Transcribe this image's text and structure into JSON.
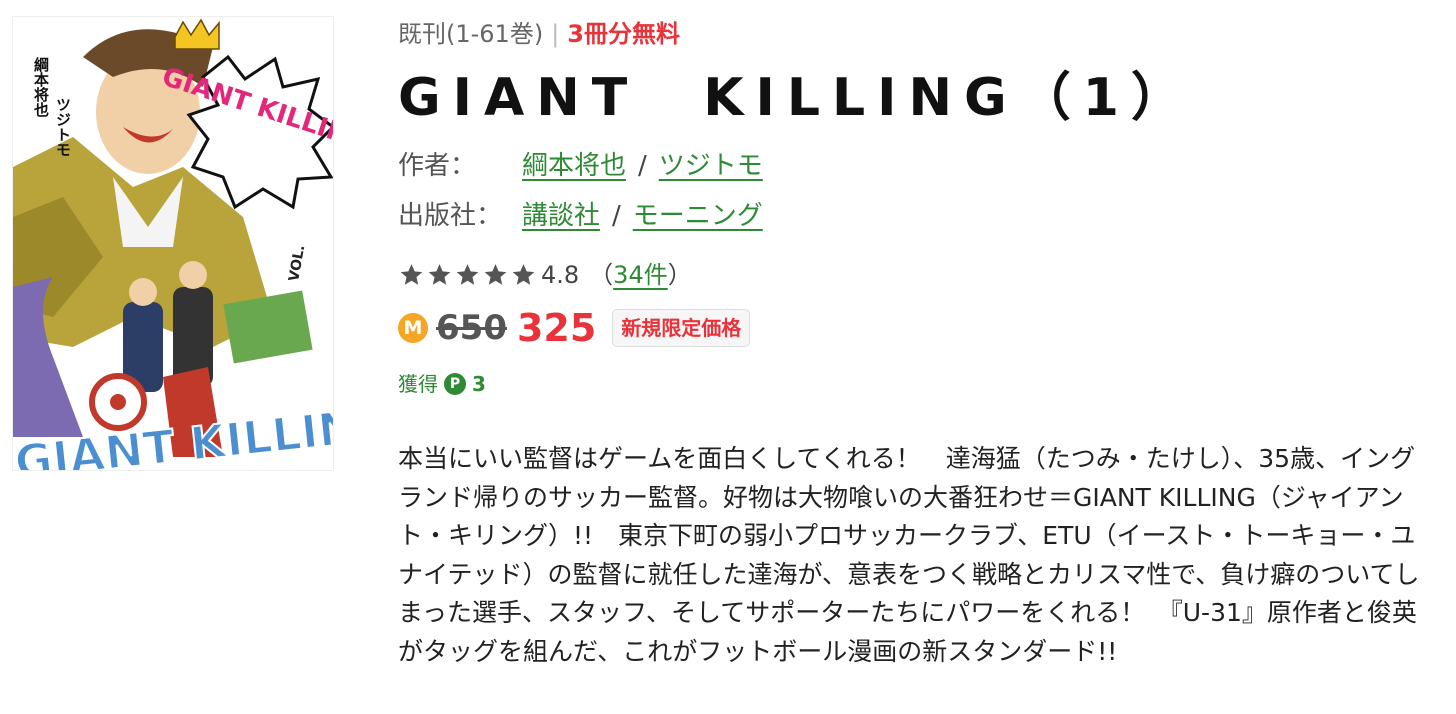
{
  "cover": {
    "alt": "GIANT KILLING 1 cover",
    "logo_text": "GIANT KILLING",
    "vol_text": "VOL.",
    "bottom_text": "GIANT KILLING",
    "authors_vertical": [
      "綱本将也",
      "ツジトモ"
    ]
  },
  "meta": {
    "volume_range": "既刊(1-61巻)",
    "separator": "|",
    "free_text": "3冊分無料"
  },
  "title": "GIANT　KILLING（1）",
  "author": {
    "label": "作者：",
    "names": [
      "綱本将也",
      "ツジトモ"
    ],
    "separator": "/"
  },
  "publisher": {
    "label": "出版社：",
    "names": [
      "講談社",
      "モーニング"
    ],
    "separator": "/"
  },
  "rating": {
    "stars": 4.8,
    "value_text": "4.8",
    "open_paren": "（",
    "review_count": "34件",
    "close_paren": "）"
  },
  "price": {
    "coin_letter": "M",
    "original": "650",
    "sale": "325",
    "badge": "新規限定価格"
  },
  "points": {
    "label": "獲得",
    "icon_letter": "P",
    "value": "3"
  },
  "description": "本当にいい監督はゲームを面白くしてくれる！　達海猛（たつみ・たけし）、35歳、イングランド帰りのサッカー監督。好物は大物喰いの大番狂わせ＝GIANT KILLING（ジャイアント・キリング）!!　東京下町の弱小プロサッカークラブ、ETU（イースト・トーキョー・ユナイテッド）の監督に就任した達海が、意表をつく戦略とカリスマ性で、負け癖のついてしまった選手、スタッフ、そしてサポーターたちにパワーをくれる！　『U-31』原作者と俊英がタッグを組んだ、これがフットボール漫画の新スタンダード!!",
  "colors": {
    "link_green": "#2f8a35",
    "sale_red": "#e8333a",
    "coin_orange": "#f5a623"
  }
}
